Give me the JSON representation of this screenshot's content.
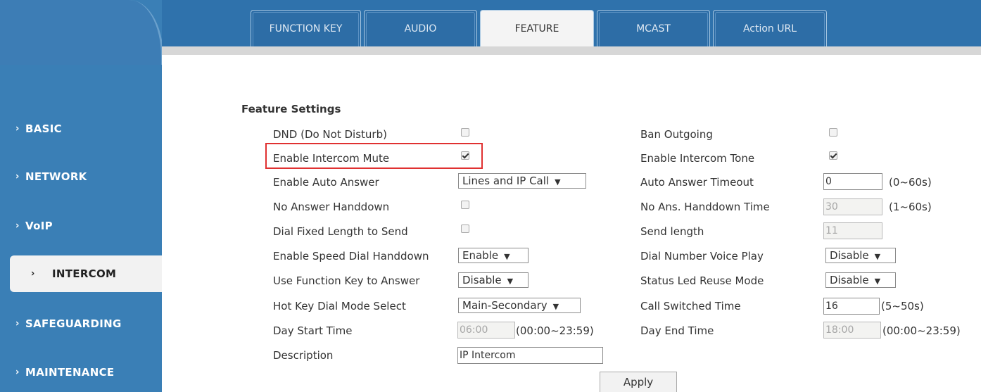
{
  "sidebar": {
    "items": [
      {
        "label": "BASIC",
        "chevron": "›"
      },
      {
        "label": "NETWORK",
        "chevron": "›"
      },
      {
        "label": "VoIP",
        "chevron": "›"
      },
      {
        "label": "INTERCOM",
        "chevron": "›"
      },
      {
        "label": "SAFEGUARDING",
        "chevron": "›"
      },
      {
        "label": "MAINTENANCE",
        "chevron": "›"
      }
    ],
    "active": "INTERCOM"
  },
  "tabs": [
    {
      "label": "FUNCTION KEY"
    },
    {
      "label": "AUDIO"
    },
    {
      "label": "FEATURE"
    },
    {
      "label": "MCAST"
    },
    {
      "label": "Action URL"
    }
  ],
  "active_tab": "FEATURE",
  "section_title": "Feature Settings",
  "left": {
    "dnd": {
      "label": "DND (Do Not Disturb)",
      "checked": false
    },
    "intercom_mute": {
      "label": "Enable Intercom Mute",
      "checked": true
    },
    "auto_answer": {
      "label": "Enable Auto Answer",
      "value": "Lines and IP Call"
    },
    "no_answer_handdown": {
      "label": "No Answer Handdown",
      "checked": false
    },
    "dial_fixed_length": {
      "label": "Dial Fixed Length to Send",
      "checked": false
    },
    "speed_dial_handdown": {
      "label": "Enable Speed Dial Handdown",
      "value": "Enable"
    },
    "function_key_answer": {
      "label": "Use Function Key to Answer",
      "value": "Disable"
    },
    "hot_key_mode": {
      "label": "Hot Key Dial Mode Select",
      "value": "Main-Secondary"
    },
    "day_start": {
      "label": "Day Start Time",
      "value": "06:00",
      "hint": "(00:00~23:59)"
    },
    "description": {
      "label": "Description",
      "value": "IP Intercom"
    }
  },
  "right": {
    "ban_outgoing": {
      "label": "Ban Outgoing",
      "checked": false
    },
    "intercom_tone": {
      "label": "Enable Intercom Tone",
      "checked": true
    },
    "auto_answer_timeout": {
      "label": "Auto Answer Timeout",
      "value": "0",
      "hint": "(0~60s)"
    },
    "no_ans_handdown_time": {
      "label": "No Ans. Handdown Time",
      "value": "30",
      "hint": "(1~60s)"
    },
    "send_length": {
      "label": "Send length",
      "value": "11"
    },
    "dial_number_voice": {
      "label": "Dial Number Voice Play",
      "value": "Disable"
    },
    "status_led": {
      "label": "Status Led Reuse Mode",
      "value": "Disable"
    },
    "call_switched_time": {
      "label": "Call Switched Time",
      "value": "16",
      "hint": "(5~50s)"
    },
    "day_end": {
      "label": "Day End Time",
      "value": "18:00",
      "hint": "(00:00~23:59)"
    }
  },
  "apply_label": "Apply",
  "colors": {
    "sidebar": "#3a7fb6",
    "topbar": "#2f72ac",
    "highlight": "#e03131"
  }
}
